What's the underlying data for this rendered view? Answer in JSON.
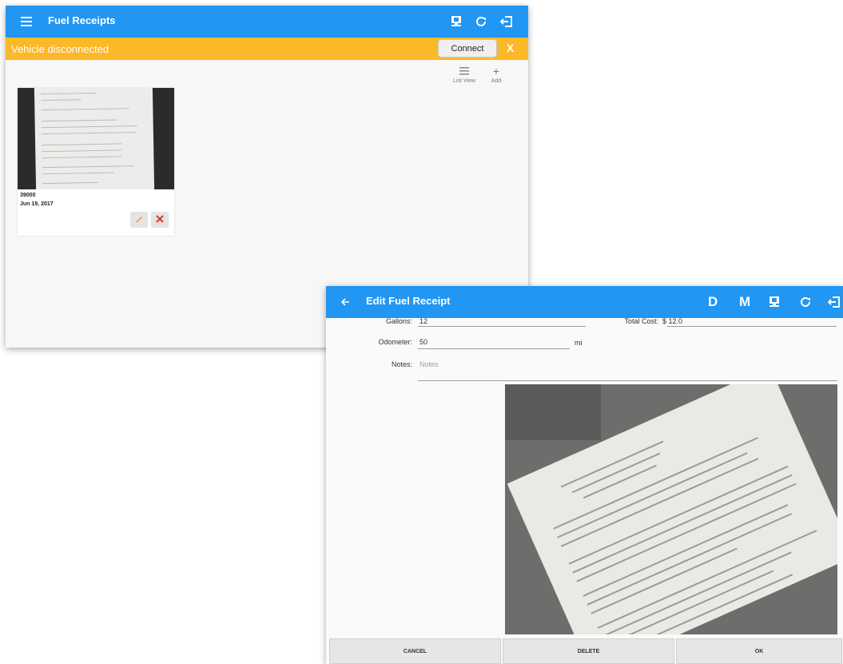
{
  "window1": {
    "title": "Fuel Receipts",
    "banner": {
      "message": "Vehicle disconnected",
      "connect_label": "Connect",
      "close_label": "X"
    },
    "toolbar": {
      "list_view_label": "List View",
      "add_label": "Add"
    },
    "receipt_card": {
      "odometer": "39000",
      "date": "Jun 19, 2017"
    }
  },
  "window2": {
    "title": "Edit Fuel Receipt",
    "icons": {
      "d_label": "D",
      "m_label": "M"
    },
    "form": {
      "gallons_label": "Gallons:",
      "gallons_value": "12",
      "total_cost_label": "Total Cost:",
      "total_cost_value": "$ 12.0",
      "odometer_label": "Odometer:",
      "odometer_value": "50",
      "odometer_unit": "mi",
      "notes_label": "Notes:",
      "notes_placeholder": "Notes"
    },
    "buttons": {
      "cancel": "CANCEL",
      "delete": "DELETE",
      "ok": "OK"
    }
  },
  "colors": {
    "appbar": "#2196f3",
    "banner": "#fbb829",
    "delete_x": "#e53935",
    "edit_pencil": "#f4a300"
  }
}
